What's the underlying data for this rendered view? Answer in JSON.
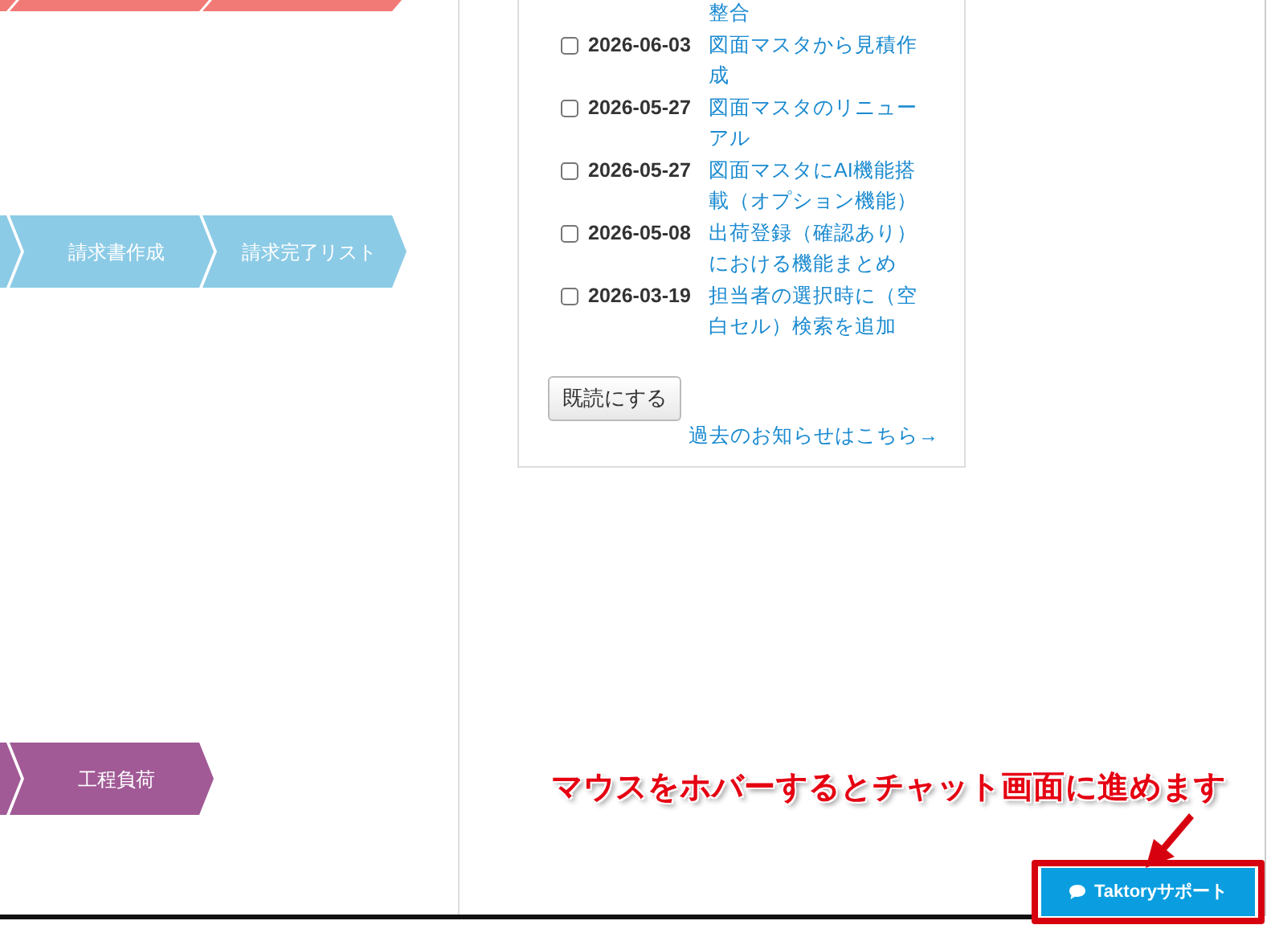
{
  "process_rows": [
    {
      "color": "#f27a76",
      "steps": [
        {
          "kind": "partial"
        },
        {
          "kind": "partial"
        },
        {
          "kind": "partial"
        }
      ]
    },
    {
      "color": "#8ccbe6",
      "steps": [
        {
          "kind": "partial"
        },
        {
          "kind": "step",
          "label": "請求書作成"
        },
        {
          "kind": "step",
          "label": "請求完了リスト"
        }
      ]
    },
    {
      "color": "#a15a96",
      "steps": [
        {
          "kind": "partial"
        },
        {
          "kind": "step",
          "label": "工程負荷"
        }
      ]
    }
  ],
  "news": {
    "items": [
      {
        "kind": "tail",
        "title": "整合"
      },
      {
        "kind": "item",
        "checked": false,
        "date": "2026-06-03",
        "title": "図面マスタから見積作成"
      },
      {
        "kind": "item",
        "checked": false,
        "date": "2026-05-27",
        "title": "図面マスタのリニューアル"
      },
      {
        "kind": "item",
        "checked": false,
        "date": "2026-05-27",
        "title": "図面マスタにAI機能搭載（オプション機能）"
      },
      {
        "kind": "item",
        "checked": false,
        "date": "2026-05-08",
        "title": "出荷登録（確認あり）における機能まとめ"
      },
      {
        "kind": "item",
        "checked": false,
        "date": "2026-03-19",
        "title": "担当者の選択時に（空白セル）検索を追加"
      }
    ],
    "button": "既読にする",
    "archive_link": "過去のお知らせはこちら→"
  },
  "annotation": "マウスをホバーするとチャット画面に進めます",
  "support_button": "Taktoryサポート"
}
